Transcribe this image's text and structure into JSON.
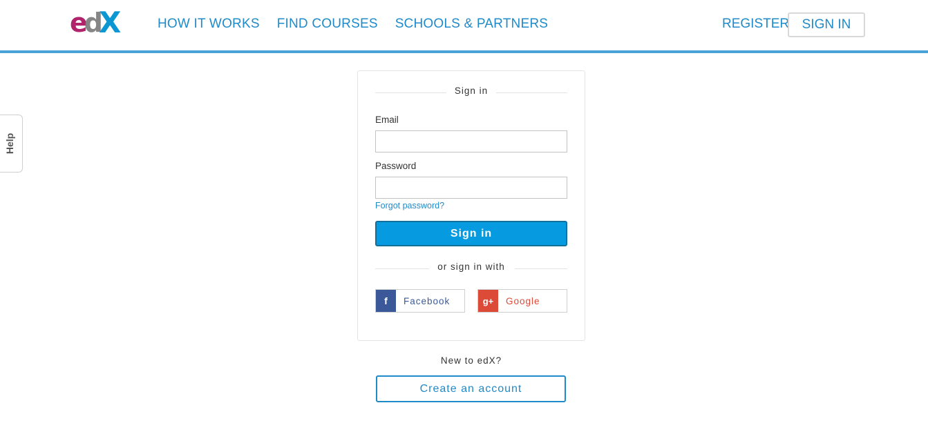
{
  "header": {
    "logo": {
      "e": "e",
      "d": "d",
      "x": "X"
    },
    "nav": [
      "HOW IT WORKS",
      "FIND COURSES",
      "SCHOOLS & PARTNERS"
    ],
    "register": "REGISTER",
    "sign_in": "SIGN IN"
  },
  "help": {
    "label": "Help"
  },
  "login": {
    "title": "Sign in",
    "email_label": "Email",
    "email_value": "",
    "password_label": "Password",
    "password_value": "",
    "forgot": "Forgot password?",
    "submit": "Sign in",
    "or_with": "or sign in with",
    "social": [
      {
        "name": "Facebook",
        "icon": "facebook-icon",
        "color": "#3b5998",
        "glyph": "f"
      },
      {
        "name": "Google",
        "icon": "google-plus-icon",
        "color": "#dc4a38",
        "glyph": "g+"
      }
    ]
  },
  "signup": {
    "prompt": "New to edX?",
    "button": "Create an account"
  },
  "colors": {
    "accent": "#1f8ac9",
    "header_border": "#4aa3d8",
    "primary": "#069ae1"
  }
}
